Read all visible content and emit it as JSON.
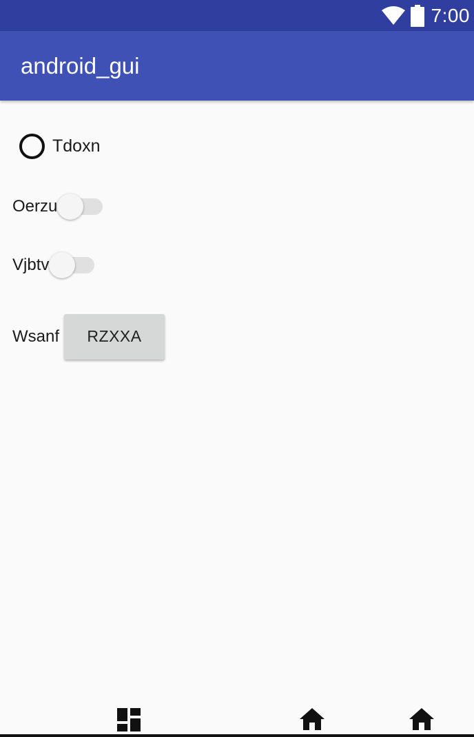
{
  "status_bar": {
    "time": "7:00",
    "icons": [
      "wifi-icon",
      "battery-icon"
    ]
  },
  "app_bar": {
    "title": "android_gui"
  },
  "content": {
    "radio": {
      "label": "Tdoxn",
      "checked": false
    },
    "switches": [
      {
        "label": "Oerzu",
        "on": false
      },
      {
        "label": "Vjbtv",
        "on": false
      }
    ],
    "button_row": {
      "label": "Wsanf",
      "button_label": "RZXXA"
    }
  },
  "bottom_nav": {
    "icons": [
      "dashboard-icon",
      "home-icon",
      "home-icon"
    ]
  },
  "colors": {
    "status_bar": "#303f9f",
    "app_bar": "#3f51b5",
    "background": "#fafafa",
    "button": "#d6d7d7"
  }
}
